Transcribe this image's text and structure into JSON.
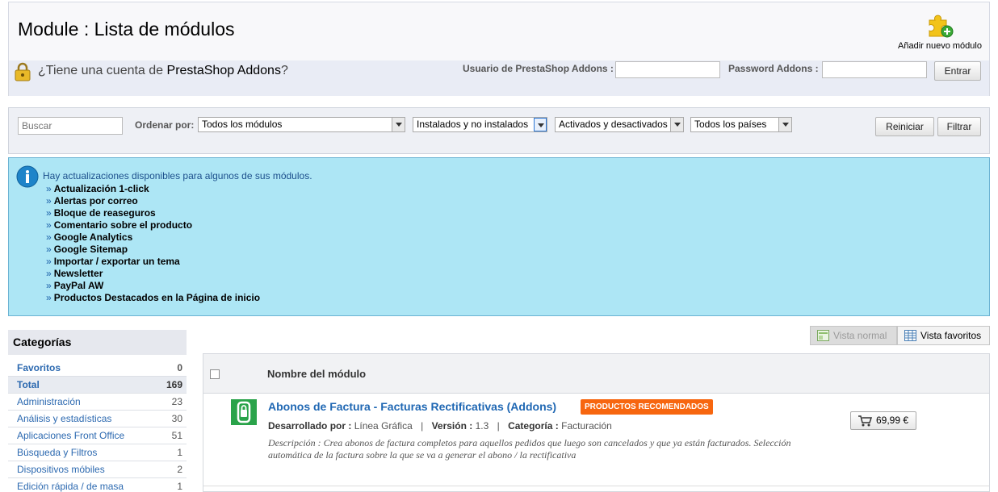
{
  "header": {
    "title": "Module : Lista de módulos",
    "add_module_label": "Añadir nuevo módulo"
  },
  "addons": {
    "question_prefix": "¿Tiene una cuenta de ",
    "question_brand": "PrestaShop Addons",
    "question_suffix": "?",
    "user_label": "Usuario de PrestaShop Addons :",
    "user_value": "",
    "password_label": "Password Addons :",
    "password_value": "",
    "login_button": "Entrar"
  },
  "filters": {
    "search_placeholder": "Buscar",
    "order_label": "Ordenar por:",
    "select_modules": "Todos los módulos",
    "select_installed": "Instalados y no instalados",
    "select_enabled": "Activados y desactivados",
    "select_countries": "Todos los países",
    "reset_button": "Reiniciar",
    "filter_button": "Filtrar"
  },
  "info": {
    "message": "Hay actualizaciones disponibles para algunos de sus módulos.",
    "bullet": "»",
    "updates": [
      "Actualización 1-click",
      "Alertas por correo",
      "Bloque de reaseguros",
      "Comentario sobre el producto",
      "Google Analytics",
      "Google Sitemap",
      "Importar / exportar un tema",
      "Newsletter",
      "PayPal AW",
      "Productos Destacados en la Página de inicio"
    ]
  },
  "categories": {
    "heading": "Categorías",
    "items": [
      {
        "label": "Favoritos",
        "count": "0"
      },
      {
        "label": "Total",
        "count": "169"
      },
      {
        "label": "Administración",
        "count": "23"
      },
      {
        "label": "Análisis y estadísticas",
        "count": "30"
      },
      {
        "label": "Aplicaciones Front Office",
        "count": "51"
      },
      {
        "label": "Búsqueda y Filtros",
        "count": "1"
      },
      {
        "label": "Dispositivos móbiles",
        "count": "2"
      },
      {
        "label": "Edición rápida / de masa",
        "count": "1"
      }
    ]
  },
  "views": {
    "normal_label": "Vista normal",
    "favorites_label": "Vista favoritos"
  },
  "module_table": {
    "column_name": "Nombre del módulo",
    "modules": [
      {
        "name": "Abonos de Factura - Facturas Rectificativas (Addons)",
        "badge": "PRODUCTOS RECOMENDADOS",
        "developer_label": "Desarrollado por :",
        "developer": "Línea Gráfica",
        "version_label": "Versión :",
        "version": "1.3",
        "category_label": "Categoría :",
        "category": "Facturación",
        "separator": "|",
        "description": "Descripción : Crea abonos de factura completos para aquellos pedidos que luego son cancelados y que ya están facturados. Selección automática de la factura sobre la que se va a generar el abono / la rectificativa",
        "price": "69,99 €",
        "icon": "lock-device-icon"
      }
    ]
  },
  "colors": {
    "info_bg": "#ade6f5",
    "link": "#1f67b3",
    "badge": "#f7660f",
    "module_icon": "#2aa34a"
  }
}
